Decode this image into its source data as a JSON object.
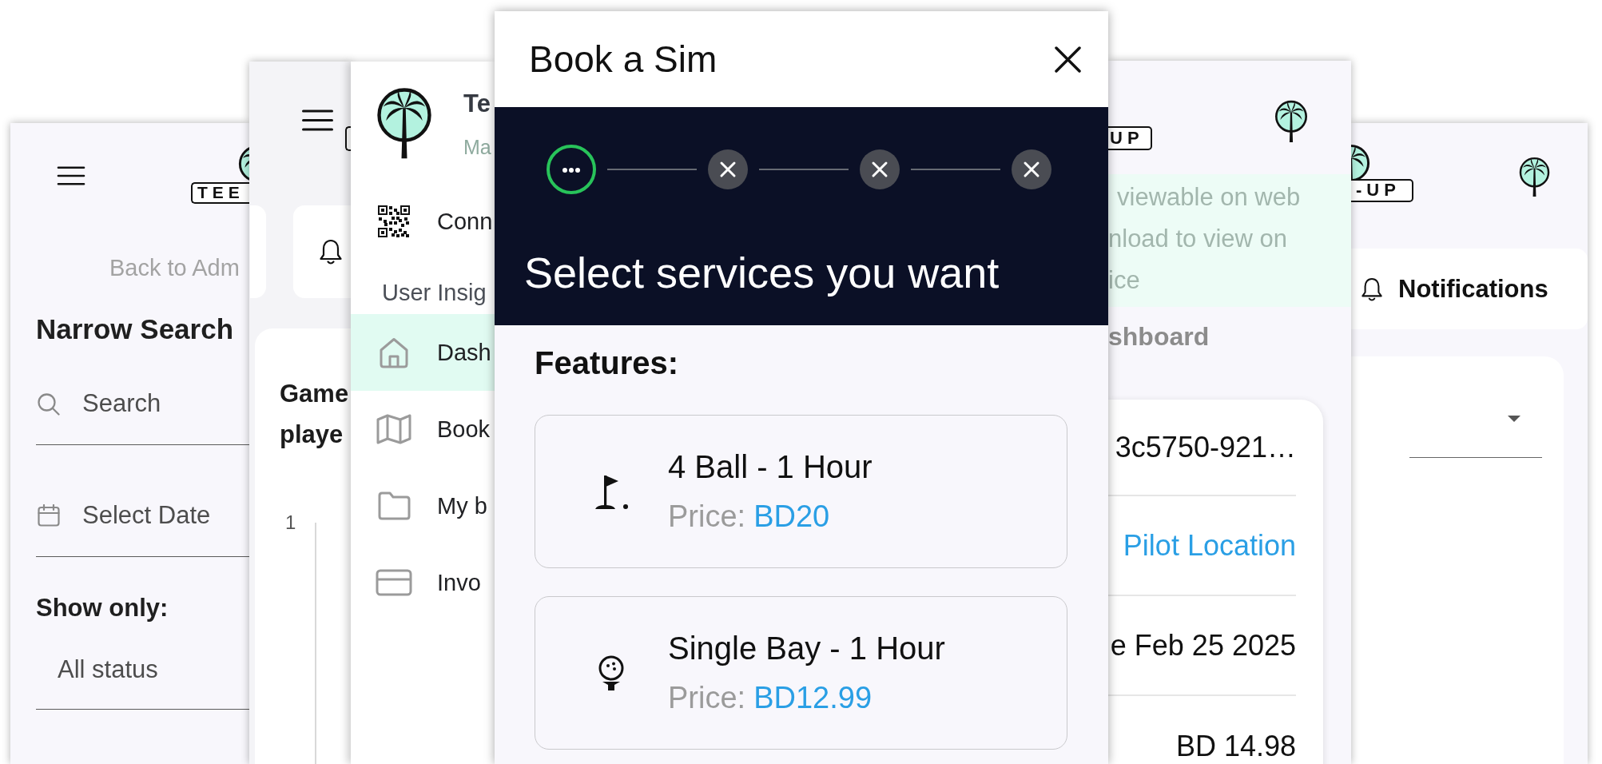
{
  "filter_screen": {
    "logo_text": "TEE",
    "back_link": "Back to Adm",
    "heading": "Narrow Search",
    "search": {
      "placeholder": "Search"
    },
    "date": {
      "placeholder": "Select Date"
    },
    "show_only_label": "Show only:",
    "status_select": {
      "value": "All status"
    }
  },
  "dashboard_screen": {
    "chart": {
      "title_lines": [
        "Game",
        "playe"
      ],
      "y_tick_label": "1"
    }
  },
  "drawer": {
    "title": "Te",
    "subtitle": "Ma",
    "top_items": [
      {
        "label": "Conn",
        "selected": false
      }
    ],
    "section_title": "User Insig",
    "section_items": [
      {
        "label": "Dash",
        "selected": true
      },
      {
        "label": "Book",
        "selected": false
      },
      {
        "label": "My b",
        "selected": false
      },
      {
        "label": "Invo",
        "selected": false
      }
    ]
  },
  "dialog": {
    "title": "Book a Sim",
    "steps": [
      {
        "active": true
      },
      {
        "active": false
      },
      {
        "active": false
      },
      {
        "active": false
      }
    ],
    "heading": "Select services you want",
    "section_label": "Features:",
    "services": [
      {
        "name": "4 Ball - 1 Hour",
        "price_label": "Price:",
        "price": "BD20"
      },
      {
        "name": "Single Bay - 1 Hour",
        "price_label": "Price:",
        "price": "BD12.99"
      }
    ]
  },
  "booking_screen": {
    "logo_text": "UP",
    "notice_lines": [
      "viewable on web",
      "nload to view on",
      "ice"
    ],
    "page_title": "shboard",
    "details": [
      {
        "kind": "text",
        "value": "3c5750-921…"
      },
      {
        "kind": "link",
        "value": "Pilot Location"
      },
      {
        "kind": "text",
        "value": "e Feb 25 2025"
      },
      {
        "kind": "text",
        "value": "BD 14.98"
      }
    ]
  },
  "notifications_screen": {
    "logo_text": "-UP",
    "notifications_button": "Notifications"
  }
}
